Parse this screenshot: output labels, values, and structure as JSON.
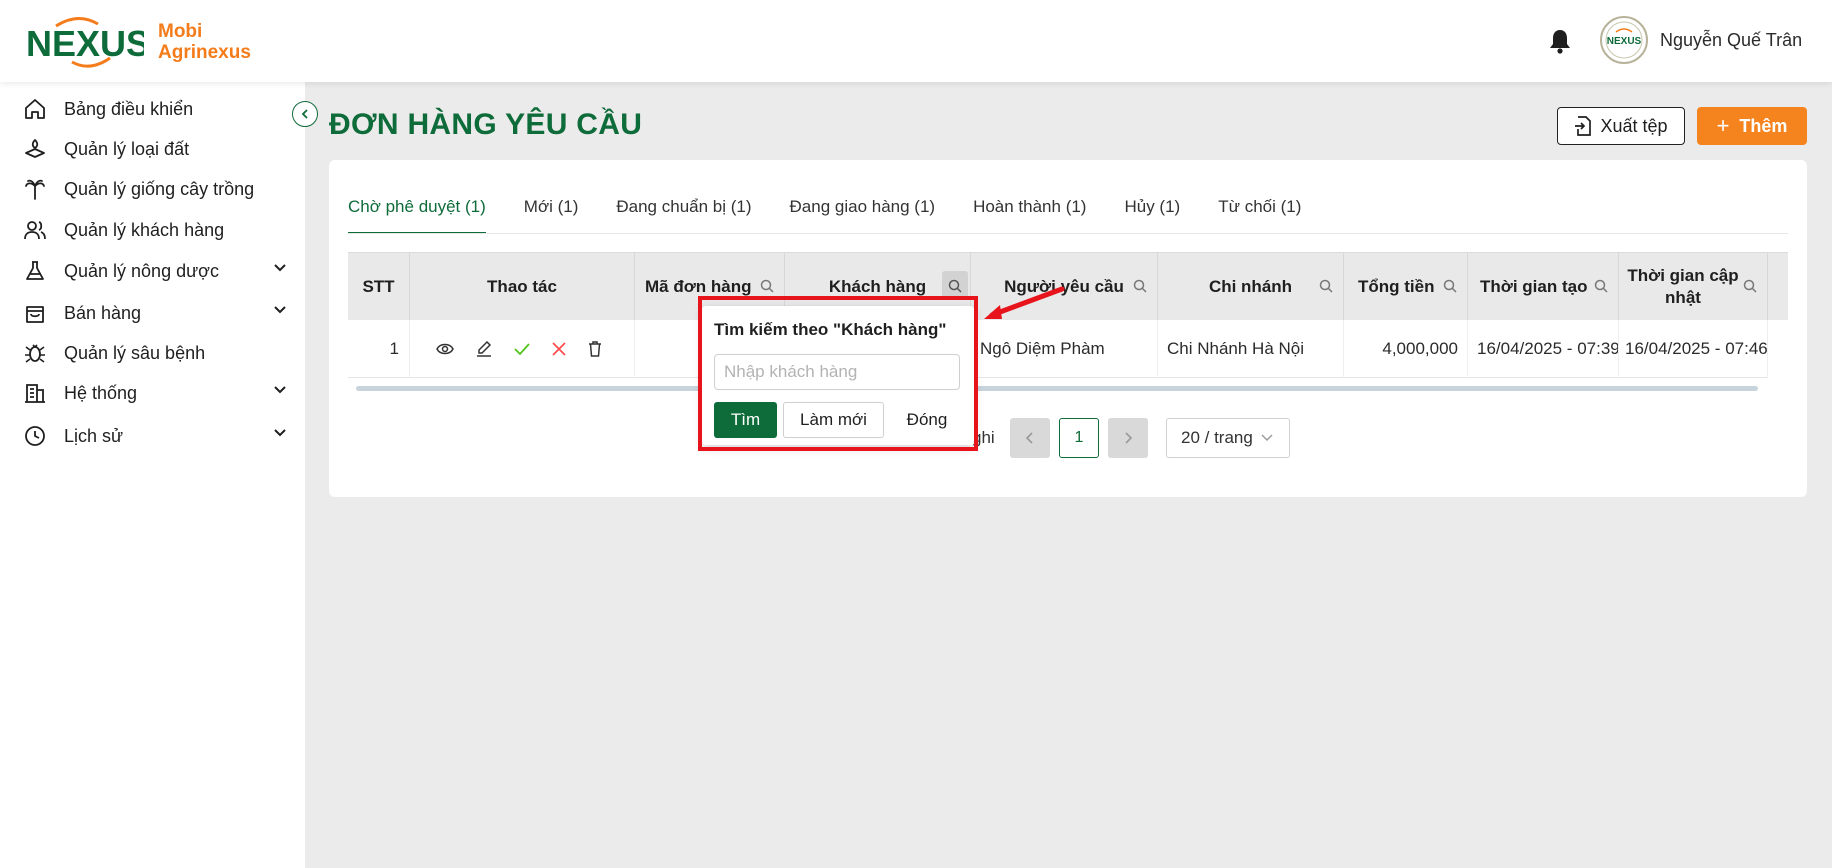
{
  "header": {
    "logo_word": "NEXUS",
    "brand_line1": "Mobi",
    "brand_line2": "Agrinexus",
    "user_name": "Nguyễn Quế Trân",
    "avatar_text": "NEXUS"
  },
  "sidebar": {
    "items": [
      {
        "label": "Bảng điều khiển",
        "icon": "home-icon",
        "has_chevron": false
      },
      {
        "label": "Quản lý loại đất",
        "icon": "land-icon",
        "has_chevron": false
      },
      {
        "label": "Quản lý giống cây trồng",
        "icon": "palm-tree-icon",
        "has_chevron": false
      },
      {
        "label": "Quản lý khách hàng",
        "icon": "users-icon",
        "has_chevron": false
      },
      {
        "label": "Quản lý nông dược",
        "icon": "flask-icon",
        "has_chevron": true
      },
      {
        "label": "Bán hàng",
        "icon": "shopping-bag-icon",
        "has_chevron": true
      },
      {
        "label": "Quản lý sâu bệnh",
        "icon": "bug-icon",
        "has_chevron": false
      },
      {
        "label": "Hệ thống",
        "icon": "building-icon",
        "has_chevron": true
      },
      {
        "label": "Lịch sử",
        "icon": "clock-icon",
        "has_chevron": true
      }
    ]
  },
  "page": {
    "title": "ĐƠN HÀNG YÊU CẦU",
    "export_label": "Xuất tệp",
    "add_label": "Thêm"
  },
  "tabs": [
    {
      "label": "Chờ phê duyệt (1)",
      "active": true
    },
    {
      "label": "Mới (1)",
      "active": false
    },
    {
      "label": "Đang chuẩn bị (1)",
      "active": false
    },
    {
      "label": "Đang giao hàng (1)",
      "active": false
    },
    {
      "label": "Hoàn thành (1)",
      "active": false
    },
    {
      "label": "Hủy (1)",
      "active": false
    },
    {
      "label": "Từ chối (1)",
      "active": false
    }
  ],
  "table": {
    "columns": [
      "STT",
      "Thao tác",
      "Mã đơn hàng",
      "Khách hàng",
      "Người yêu cầu",
      "Chi nhánh",
      "Tổng tiền",
      "Thời gian tạo",
      "Thời gian cập nhật"
    ],
    "rows": [
      {
        "stt": "1",
        "order_code": "",
        "customer": "",
        "requester": "Ngô Diệm Phàm",
        "branch": "Chi Nhánh Hà Nội",
        "total": "4,000,000",
        "created": "16/04/2025 - 07:39",
        "updated": "16/04/2025 - 07:46"
      }
    ]
  },
  "pagination": {
    "total_text": "ghi",
    "current_page": "1",
    "page_size": "20 / trang"
  },
  "popup": {
    "title": "Tìm kiếm theo \"Khách hàng\"",
    "placeholder": "Nhập khách hàng",
    "value": "",
    "find_label": "Tìm",
    "reset_label": "Làm mới",
    "close_label": "Đóng"
  },
  "colors": {
    "brand_green": "#0e6b3a",
    "brand_orange": "#f5841f",
    "highlight_red": "#e8141c"
  }
}
